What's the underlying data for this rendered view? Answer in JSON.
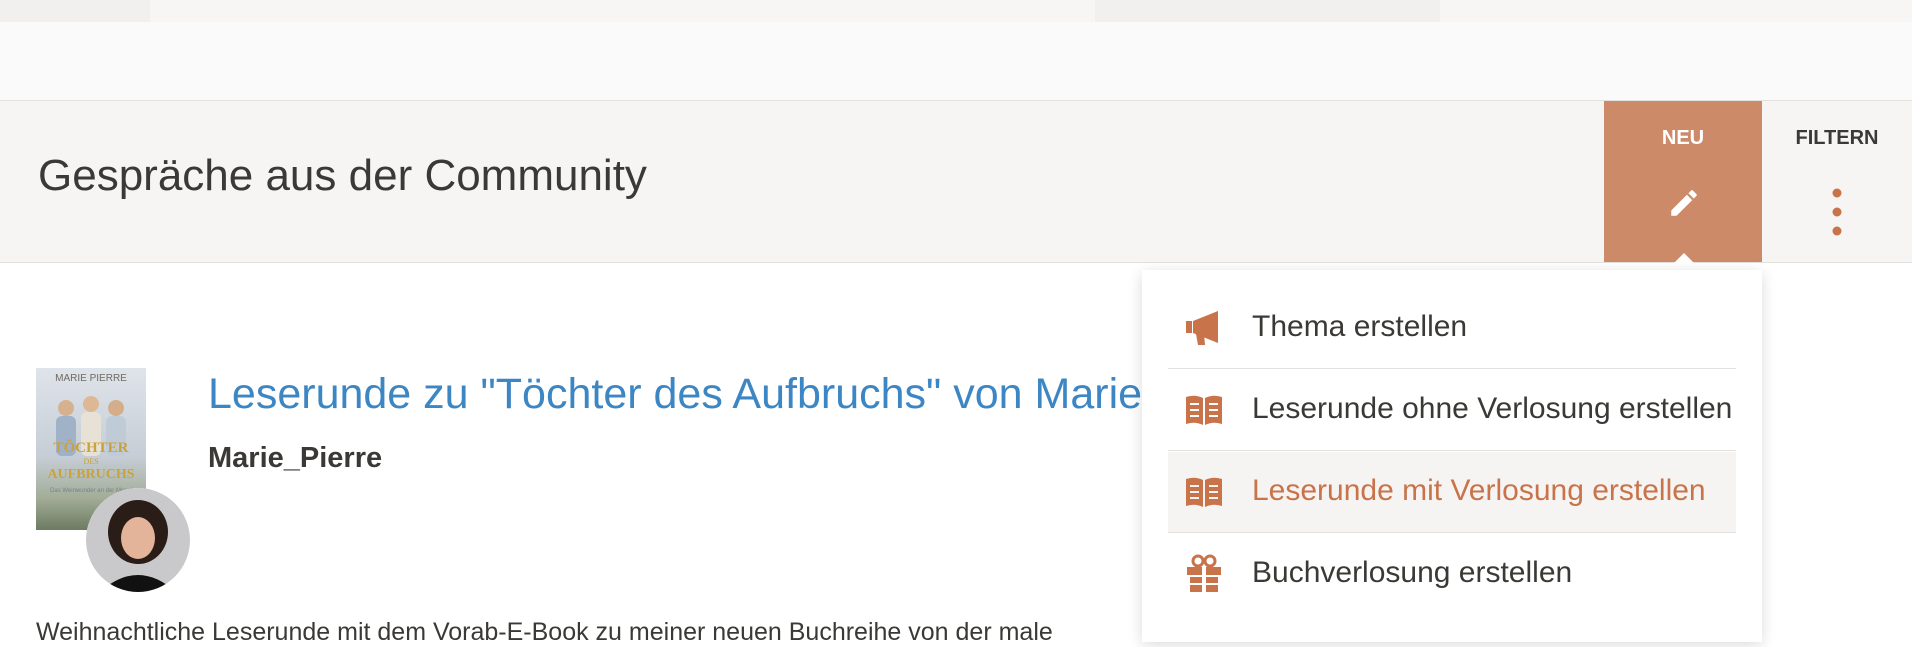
{
  "section": {
    "title": "Gespräche aus der Community"
  },
  "actions": {
    "new_label": "NEU",
    "filter_label": "FILTERN"
  },
  "post": {
    "title": "Leserunde zu \"Töchter des Aufbruchs\" von Marie",
    "author": "Marie_Pierre",
    "excerpt": "Weihnachtliche Leserunde mit dem Vorab-E-Book zu meiner neuen Buchreihe von der male",
    "cover": {
      "author_name": "MARIE PIERRE",
      "title_line1": "TÖCHTER",
      "title_line2": "DES",
      "title_line3": "AUFBRUCHS",
      "subtitle": "Das Weinwunder an der Mosel"
    }
  },
  "dropdown": {
    "items": [
      {
        "label": "Thema erstellen",
        "icon": "megaphone-icon",
        "active": false
      },
      {
        "label": "Leserunde ohne Verlosung erstellen",
        "icon": "open-book-icon",
        "active": false
      },
      {
        "label": "Leserunde mit Verlosung erstellen",
        "icon": "open-book-icon",
        "active": true
      },
      {
        "label": "Buchverlosung erstellen",
        "icon": "gift-icon",
        "active": false
      }
    ]
  },
  "colors": {
    "accent": "#cd8a69",
    "accent_text": "#c8734a",
    "link": "#3c86c4",
    "header_bg": "#f6f5f3"
  }
}
